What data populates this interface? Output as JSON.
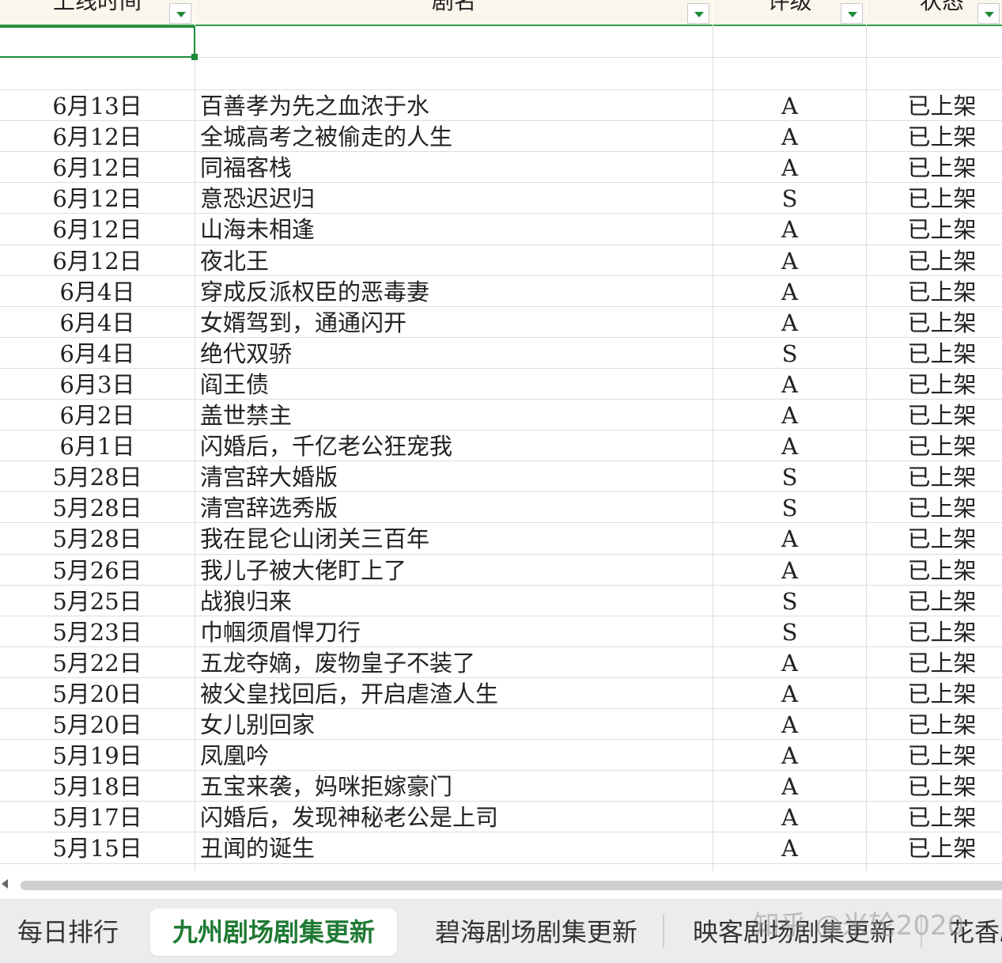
{
  "headers": {
    "date": "上线时间",
    "name": "剧名",
    "level": "评级",
    "status": "状态"
  },
  "rows": [
    {
      "date": "6月13日",
      "name": "百善孝为先之血浓于水",
      "level": "A",
      "status": "已上架"
    },
    {
      "date": "6月12日",
      "name": "全城高考之被偷走的人生",
      "level": "A",
      "status": "已上架"
    },
    {
      "date": "6月12日",
      "name": "同福客栈",
      "level": "A",
      "status": "已上架"
    },
    {
      "date": "6月12日",
      "name": "意恐迟迟归",
      "level": "S",
      "status": "已上架"
    },
    {
      "date": "6月12日",
      "name": "山海未相逢",
      "level": "A",
      "status": "已上架"
    },
    {
      "date": "6月12日",
      "name": "夜北王",
      "level": "A",
      "status": "已上架"
    },
    {
      "date": "6月4日",
      "name": "穿成反派权臣的恶毒妻",
      "level": "A",
      "status": "已上架"
    },
    {
      "date": "6月4日",
      "name": "女婿驾到，通通闪开",
      "level": "A",
      "status": "已上架"
    },
    {
      "date": "6月4日",
      "name": "绝代双骄",
      "level": "S",
      "status": "已上架"
    },
    {
      "date": "6月3日",
      "name": "阎王债",
      "level": "A",
      "status": "已上架"
    },
    {
      "date": "6月2日",
      "name": "盖世禁主",
      "level": "A",
      "status": "已上架"
    },
    {
      "date": "6月1日",
      "name": "闪婚后，千亿老公狂宠我",
      "level": "A",
      "status": "已上架"
    },
    {
      "date": "5月28日",
      "name": "清宫辞大婚版",
      "level": "S",
      "status": "已上架"
    },
    {
      "date": "5月28日",
      "name": "清宫辞选秀版",
      "level": "S",
      "status": "已上架"
    },
    {
      "date": "5月28日",
      "name": "我在昆仑山闭关三百年",
      "level": "A",
      "status": "已上架"
    },
    {
      "date": "5月26日",
      "name": "我儿子被大佬盯上了",
      "level": "A",
      "status": "已上架"
    },
    {
      "date": "5月25日",
      "name": "战狼归来",
      "level": "S",
      "status": "已上架"
    },
    {
      "date": "5月23日",
      "name": "巾帼须眉悍刀行",
      "level": "S",
      "status": "已上架"
    },
    {
      "date": "5月22日",
      "name": "五龙夺嫡，废物皇子不装了",
      "level": "A",
      "status": "已上架"
    },
    {
      "date": "5月20日",
      "name": "被父皇找回后，开启虐渣人生",
      "level": "A",
      "status": "已上架"
    },
    {
      "date": "5月20日",
      "name": "女儿别回家",
      "level": "A",
      "status": "已上架"
    },
    {
      "date": "5月19日",
      "name": "凤凰吟",
      "level": "A",
      "status": "已上架"
    },
    {
      "date": "5月18日",
      "name": "五宝来袭，妈咪拒嫁豪门",
      "level": "A",
      "status": "已上架"
    },
    {
      "date": "5月17日",
      "name": "闪婚后，发现神秘老公是上司",
      "level": "A",
      "status": "已上架"
    },
    {
      "date": "5月15日",
      "name": "丑闻的诞生",
      "level": "A",
      "status": "已上架"
    }
  ],
  "tabs": [
    {
      "label": "每日排行"
    },
    {
      "label": "九州剧场剧集更新",
      "active": true
    },
    {
      "label": "碧海剧场剧集更新"
    },
    {
      "label": "映客剧场剧集更新"
    },
    {
      "label": "花香剧"
    }
  ],
  "watermark": "知乎 @米轮2020",
  "colors": {
    "accent": "#1f8a3a",
    "header_bg": "#fbf6ec",
    "grid": "#dcdcdc",
    "tabbar_bg": "#ececec"
  }
}
